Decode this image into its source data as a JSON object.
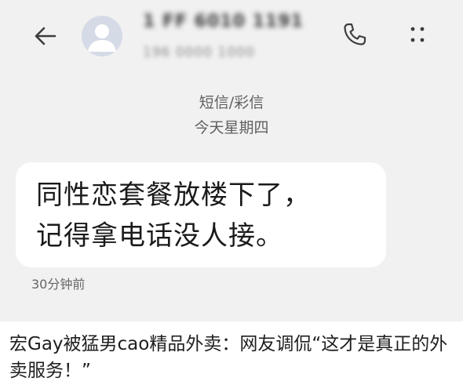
{
  "header": {
    "contact_name": "1 FF 6010 1191",
    "contact_number": "196 0000 1000",
    "icons": {
      "back": "back-arrow-icon",
      "avatar": "person-icon",
      "call": "phone-icon",
      "more": "more-vertical-icon"
    }
  },
  "thread": {
    "channel": "短信/彩信",
    "date": "今天星期四",
    "messages": [
      {
        "lines": [
          "同性恋套餐放楼下了，",
          "记得拿电话没人接。"
        ],
        "time": "30分钟前"
      }
    ]
  },
  "caption": "宏Gay被猛男cao精品外卖：网友调侃“这才是真正的外卖服务！”",
  "colors": {
    "screen_background": "#f1f1f1",
    "bubble_background": "#ffffff",
    "avatar_background": "#d5dbe6",
    "avatar_foreground": "#ffffff"
  }
}
